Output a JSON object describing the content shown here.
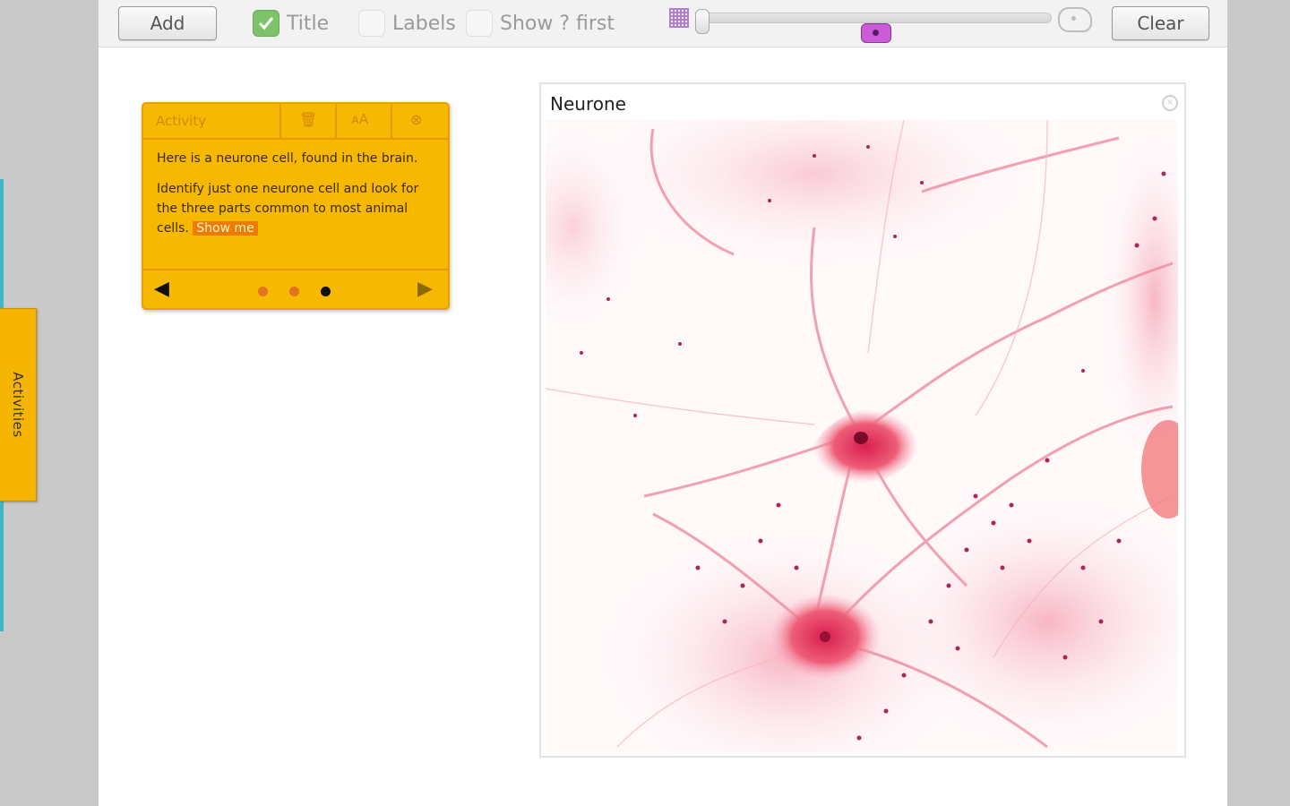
{
  "toolbar": {
    "add_label": "Add",
    "title_label": "Title",
    "title_checked": true,
    "labels_label": "Labels",
    "labels_checked": false,
    "show_first_label": "Show ? first",
    "show_first_checked": false,
    "zoom_slider_value": 0.05,
    "clear_label": "Clear"
  },
  "side_tab": {
    "label": "Activities"
  },
  "activity_card": {
    "title": "Activity",
    "delete_icon": "trash-icon",
    "font_size_icon": "text-size-icon",
    "close_icon": "close-icon",
    "paragraph_1": "Here is a neurone cell, found in the brain.",
    "paragraph_2": "Identify just one neurone cell and look for the three parts common to most animal cells.",
    "show_me_label": "Show me",
    "pages_total": 3,
    "current_page": 3
  },
  "image_panel": {
    "title": "Neurone",
    "close_icon": "close-icon"
  },
  "colors": {
    "accent_yellow": "#f6b800",
    "check_green": "#7cc36a",
    "marker_purple": "#cc5bd8",
    "left_edge_cyan": "#3fb6c6"
  }
}
